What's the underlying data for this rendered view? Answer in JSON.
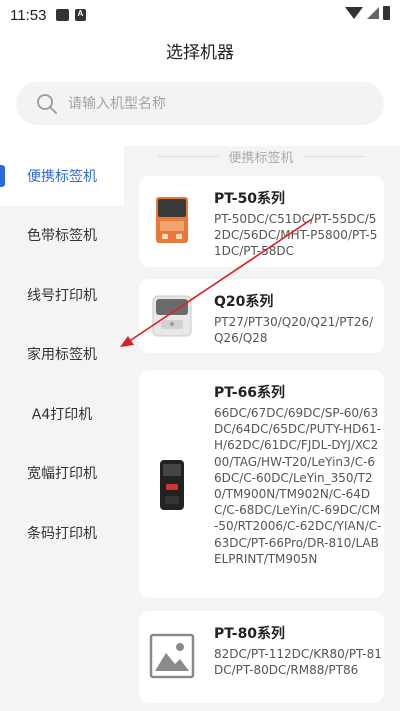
{
  "status_bar": {
    "time": "11:53",
    "left_icons": [
      "image-icon",
      "a-badge-icon"
    ],
    "right_icons": [
      "wifi-icon",
      "signal-icon",
      "battery-icon"
    ]
  },
  "header": {
    "title": "选择机器"
  },
  "search": {
    "placeholder": "请输入机型名称",
    "value": ""
  },
  "sidebar": {
    "items": [
      {
        "label": "便携标签机",
        "active": true
      },
      {
        "label": "色带标签机",
        "active": false
      },
      {
        "label": "线号打印机",
        "active": false
      },
      {
        "label": "家用标签机",
        "active": false
      },
      {
        "label": "A4打印机",
        "active": false
      },
      {
        "label": "宽幅打印机",
        "active": false
      },
      {
        "label": "条码打印机",
        "active": false
      }
    ]
  },
  "content": {
    "section_title": "便携标签机",
    "cards": [
      {
        "title": "PT-50系列",
        "models": "PT-50DC/C51DC/PT-55DC/52DC/56DC/MHT-P5800/PT-51DC/PT-58DC",
        "thumb": "orange-printer"
      },
      {
        "title": "Q20系列",
        "models": "PT27/PT30/Q20/Q21/PT26/Q26/Q28",
        "thumb": "white-printer"
      },
      {
        "title": "PT-66系列",
        "models": "66DC/67DC/69DC/SP-60/63DC/64DC/65DC/PUTY-HD61-H/62DC/61DC/FJDL-DYJ/XC200/TAG/HW-T20/LeYin3/C-66DC/C-60DC/LeYin_350/T20/TM900N/TM902N/C-64DC/C-68DC/LeYin/C-69DC/CM-50/RT2006/C-62DC/YIAN/C-63DC/PT-66Pro/DR-810/LABELPRINT/TM905N",
        "thumb": "black-printer"
      },
      {
        "title": "PT-80系列",
        "models": "82DC/PT-112DC/KR80/PT-81DC/PT-80DC/RM88/PT86",
        "thumb": "placeholder-image"
      }
    ]
  },
  "colors": {
    "accent": "#2f6bd8",
    "annotation_arrow": "#d92020",
    "panel_bg": "#f4f4f4"
  }
}
